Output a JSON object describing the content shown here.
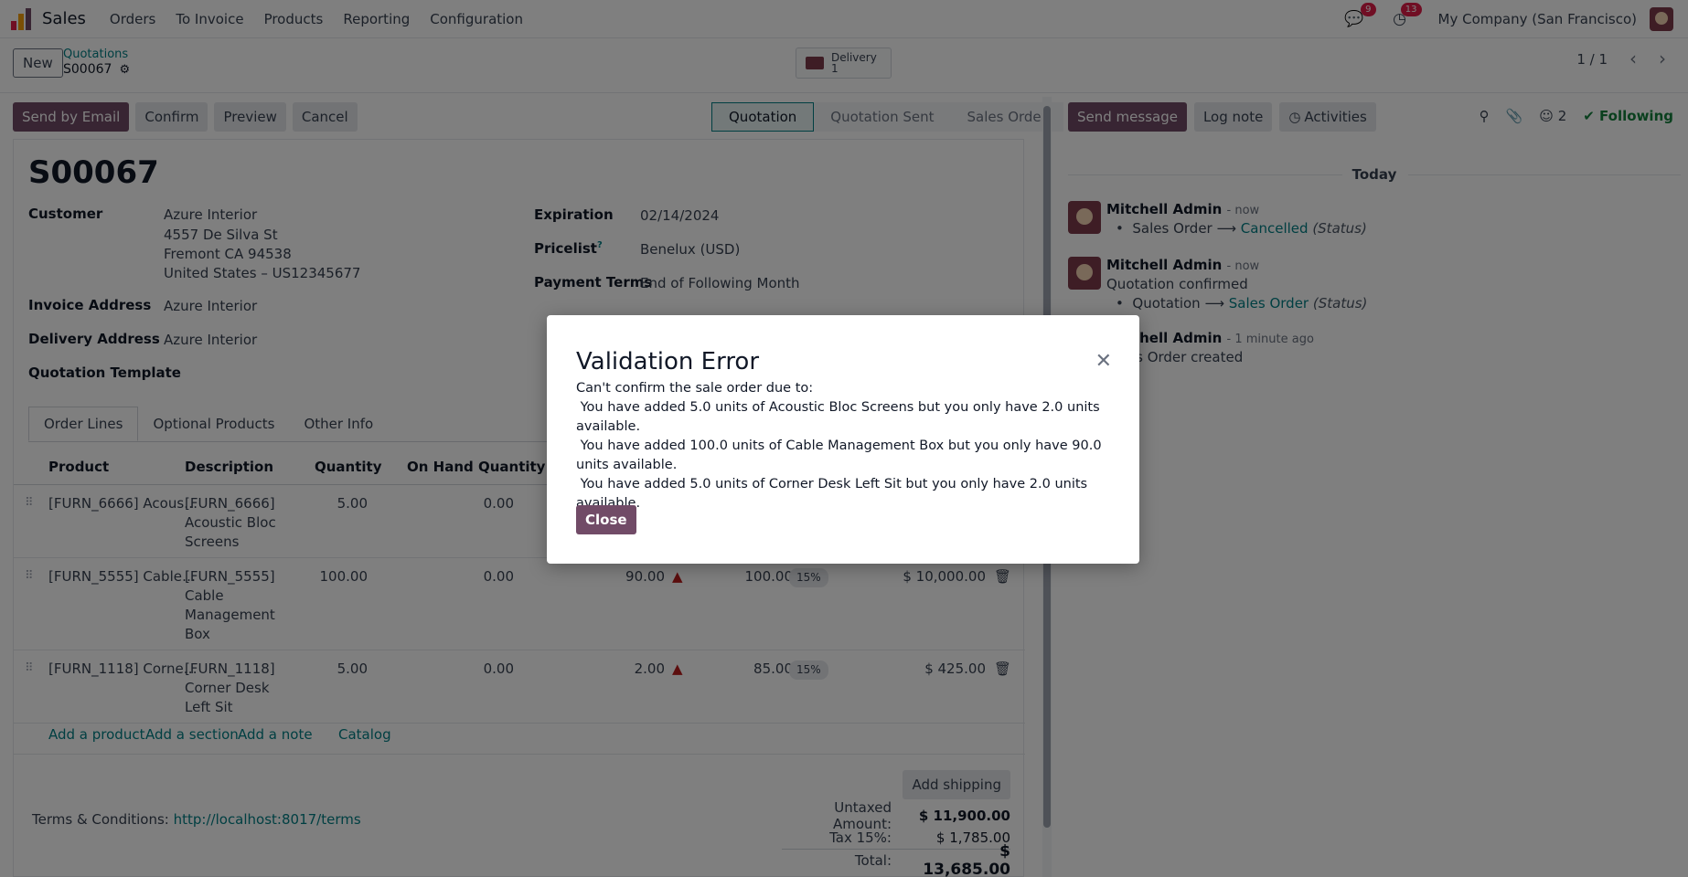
{
  "topnav": {
    "app_name": "Sales",
    "menu": [
      "Orders",
      "To Invoice",
      "Products",
      "Reporting",
      "Configuration"
    ],
    "messages_count": "9",
    "activities_count": "13",
    "company": "My Company (San Francisco)"
  },
  "control": {
    "new_label": "New",
    "breadcrumb_parent": "Quotations",
    "breadcrumb_current": "S00067",
    "delivery_label": "Delivery",
    "delivery_count": "1",
    "pager": "1 / 1"
  },
  "actions": {
    "send_email": "Send by Email",
    "confirm": "Confirm",
    "preview": "Preview",
    "cancel": "Cancel"
  },
  "statusbar": [
    "Quotation",
    "Quotation Sent",
    "Sales Order"
  ],
  "form": {
    "title": "S00067",
    "customer_label": "Customer",
    "customer_name": "Azure Interior",
    "customer_street": "4557 De Silva St",
    "customer_city": "Fremont CA 94538",
    "customer_country": "United States – US12345677",
    "invoice_label": "Invoice Address",
    "invoice_value": "Azure Interior",
    "delivery_label": "Delivery Address",
    "delivery_value": "Azure Interior",
    "template_label": "Quotation Template",
    "expiration_label": "Expiration",
    "expiration_value": "02/14/2024",
    "pricelist_label": "Pricelist",
    "pricelist_help": "?",
    "pricelist_value": "Benelux (USD)",
    "payment_label": "Payment Terms",
    "payment_value": "End of Following Month"
  },
  "tabs": [
    "Order Lines",
    "Optional Products",
    "Other Info"
  ],
  "table": {
    "headers": {
      "product": "Product",
      "description": "Description",
      "quantity": "Quantity",
      "onhand": "On Hand Quantity"
    },
    "rows": [
      {
        "product": "[FURN_6666] Acous…",
        "desc1": "[FURN_6666]",
        "desc2": "Acoustic Bloc",
        "desc3": "Screens",
        "qty": "5.00",
        "onhand": "0.00",
        "forecast": "",
        "price": "",
        "tax": "",
        "subtotal": ""
      },
      {
        "product": "[FURN_5555] Cable…",
        "desc1": "[FURN_5555]",
        "desc2": "Cable",
        "desc3": "Management",
        "desc4": "Box",
        "qty": "100.00",
        "onhand": "0.00",
        "forecast": "90.00",
        "price": "100.00",
        "tax": "15%",
        "subtotal": "$ 10,000.00"
      },
      {
        "product": "[FURN_1118] Corne…",
        "desc1": "[FURN_1118]",
        "desc2": "Corner Desk",
        "desc3": "Left Sit",
        "qty": "5.00",
        "onhand": "0.00",
        "forecast": "2.00",
        "price": "85.00",
        "tax": "15%",
        "subtotal": "$ 425.00"
      }
    ],
    "add_product": "Add a product",
    "add_section": "Add a section",
    "add_note": "Add a note",
    "catalog": "Catalog"
  },
  "footer": {
    "add_shipping": "Add shipping",
    "terms_label": "Terms & Conditions:",
    "terms_link": "http://localhost:8017/terms",
    "untaxed_label": "Untaxed Amount:",
    "untaxed_value": "$ 11,900.00",
    "tax_label": "Tax 15%:",
    "tax_value": "$ 1,785.00",
    "total_label": "Total:",
    "total_value": "$ 13,685.00"
  },
  "chatter": {
    "send_message": "Send message",
    "log_note": "Log note",
    "activities": "Activities",
    "followers": "2",
    "following": "Following",
    "today": "Today",
    "messages": [
      {
        "author": "Mitchell Admin",
        "time": "- now",
        "field": "Sales Order",
        "new_value": "Cancelled",
        "status": "(Status)"
      },
      {
        "author": "Mitchell Admin",
        "time": "- now",
        "body": "Quotation confirmed",
        "field": "Quotation",
        "new_value": "Sales Order",
        "status": "(Status)"
      },
      {
        "author": "Mitchell Admin",
        "time": "- 1 minute ago",
        "body": "Sales Order created"
      }
    ]
  },
  "modal": {
    "title": "Validation Error",
    "line0": "Can't confirm the sale order due to:",
    "line1": " You have added 5.0 units of Acoustic Bloc Screens but you only have 2.0 units available.",
    "line2": " You have added 100.0 units of Cable Management Box but you only have 90.0 units available.",
    "line3": " You have added 5.0 units of Corner Desk Left Sit but you only have 2.0 units available.",
    "close_label": "Close"
  },
  "colors": {
    "brand": "#714b67",
    "link": "#017e84",
    "badge": "#e11d48",
    "following": "#15803d"
  }
}
